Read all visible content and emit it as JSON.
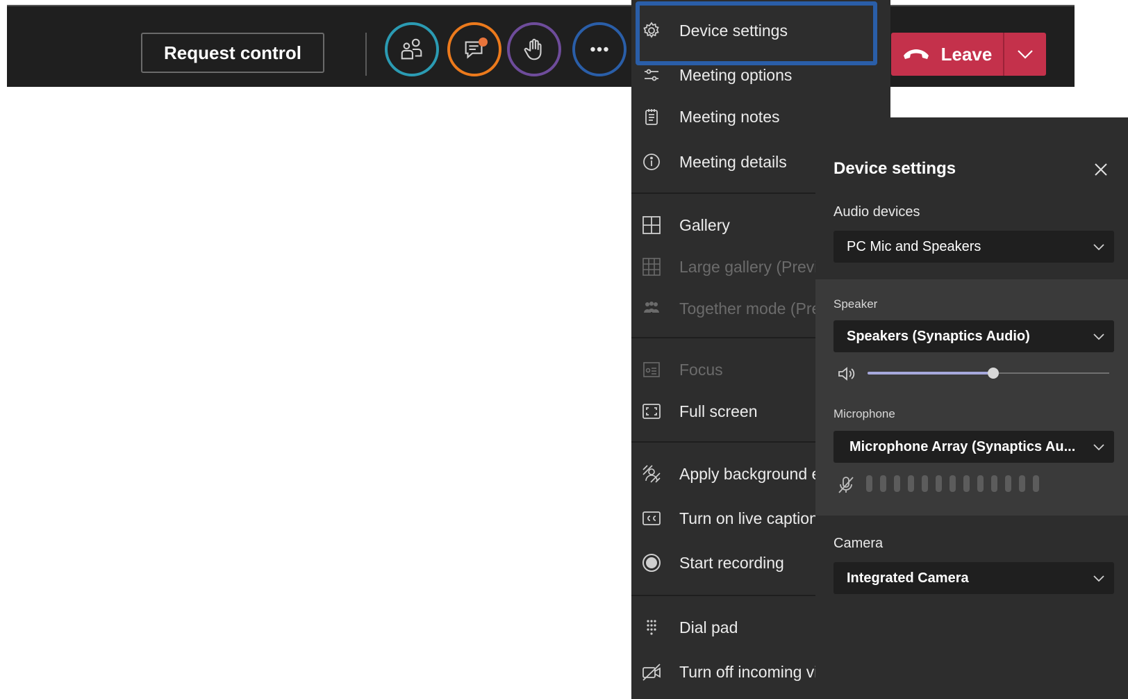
{
  "toolbar": {
    "request_control": "Request control",
    "participants_color": "#2b9bb3",
    "chat_color": "#ec7a1c",
    "raise_hand_color": "#6e4c9b",
    "more_color": "#2a5ea8",
    "leave_label": "Leave",
    "leave_color": "#c4314b"
  },
  "menu": {
    "items": [
      {
        "label": "Device settings",
        "icon": "gear-icon",
        "disabled": false
      },
      {
        "label": "Meeting options",
        "icon": "sliders-icon",
        "disabled": false
      },
      {
        "label": "Meeting notes",
        "icon": "notes-icon",
        "disabled": false
      },
      {
        "label": "Meeting details",
        "icon": "info-icon",
        "disabled": false
      },
      {
        "label": "Gallery",
        "icon": "grid-icon",
        "disabled": false
      },
      {
        "label": "Large gallery (Previe",
        "icon": "large-grid-icon",
        "disabled": true
      },
      {
        "label": "Together mode (Pre",
        "icon": "people-icon",
        "disabled": true
      },
      {
        "label": "Focus",
        "icon": "focus-icon",
        "disabled": true
      },
      {
        "label": "Full screen",
        "icon": "fullscreen-icon",
        "disabled": false
      },
      {
        "label": "Apply background e",
        "icon": "background-effects-icon",
        "disabled": false
      },
      {
        "label": "Turn on live caption",
        "icon": "captions-icon",
        "disabled": false
      },
      {
        "label": "Start recording",
        "icon": "record-icon",
        "disabled": false
      },
      {
        "label": "Dial pad",
        "icon": "dialpad-icon",
        "disabled": false
      },
      {
        "label": "Turn off incoming vi",
        "icon": "video-off-icon",
        "disabled": false
      }
    ]
  },
  "device_settings": {
    "title": "Device settings",
    "audio_devices_label": "Audio devices",
    "audio_devices_value": "PC Mic and Speakers",
    "speaker_label": "Speaker",
    "speaker_value": "Speakers (Synaptics Audio)",
    "speaker_volume": 0.52,
    "microphone_label": "Microphone",
    "microphone_value": "Microphone Array (Synaptics Au...",
    "mic_level_bars": 13,
    "camera_label": "Camera",
    "camera_value": "Integrated Camera"
  }
}
